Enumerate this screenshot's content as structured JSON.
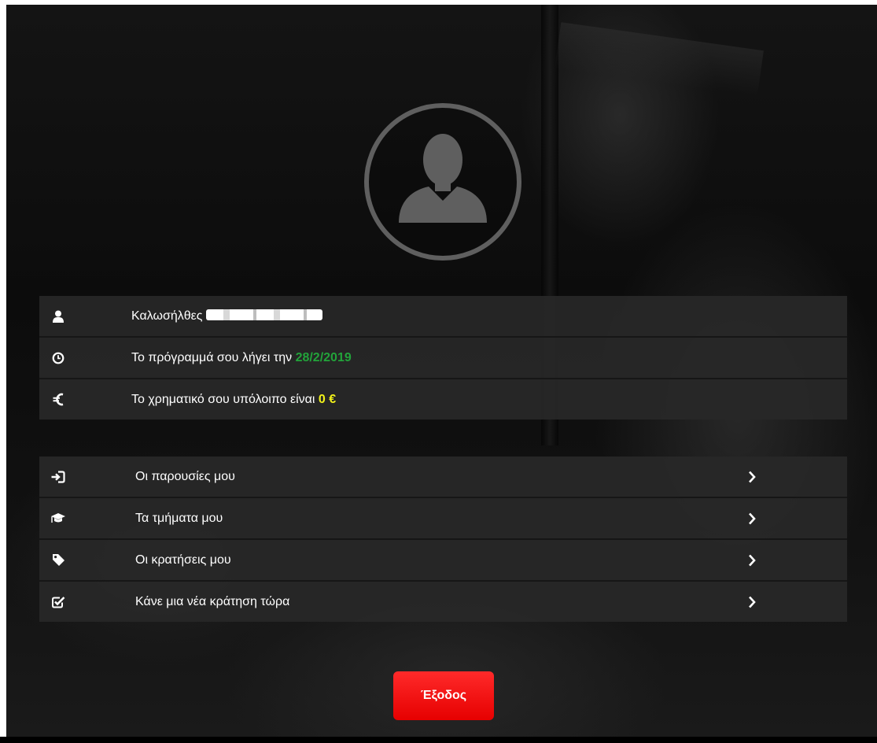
{
  "profile": {
    "avatar_icon": "user-silhouette-icon"
  },
  "info": {
    "welcome_label": "Καλωσήλθες",
    "welcome_icon": "user-icon",
    "program_label": "Το πρόγραμμά σου λήγει την",
    "program_date": "28/2/2019",
    "program_icon": "clock-icon",
    "balance_label": "Το χρηματικό σου υπόλοιπο είναι",
    "balance_value": "0 €",
    "balance_icon": "euro-icon"
  },
  "menu": {
    "items": [
      {
        "label": "Οι παρουσίες μου",
        "icon": "sign-in-icon"
      },
      {
        "label": "Τα τμήματα μου",
        "icon": "graduation-cap-icon"
      },
      {
        "label": "Οι κρατήσεις μου",
        "icon": "tag-icon"
      },
      {
        "label": "Κάνε μια νέα κράτηση τώρα",
        "icon": "check-square-icon"
      }
    ]
  },
  "logout": {
    "label": "Έξοδος"
  },
  "colors": {
    "date": "#22a33a",
    "money": "#f2f21a",
    "logout": "#ff1a1a",
    "row_bg": "#282828"
  }
}
